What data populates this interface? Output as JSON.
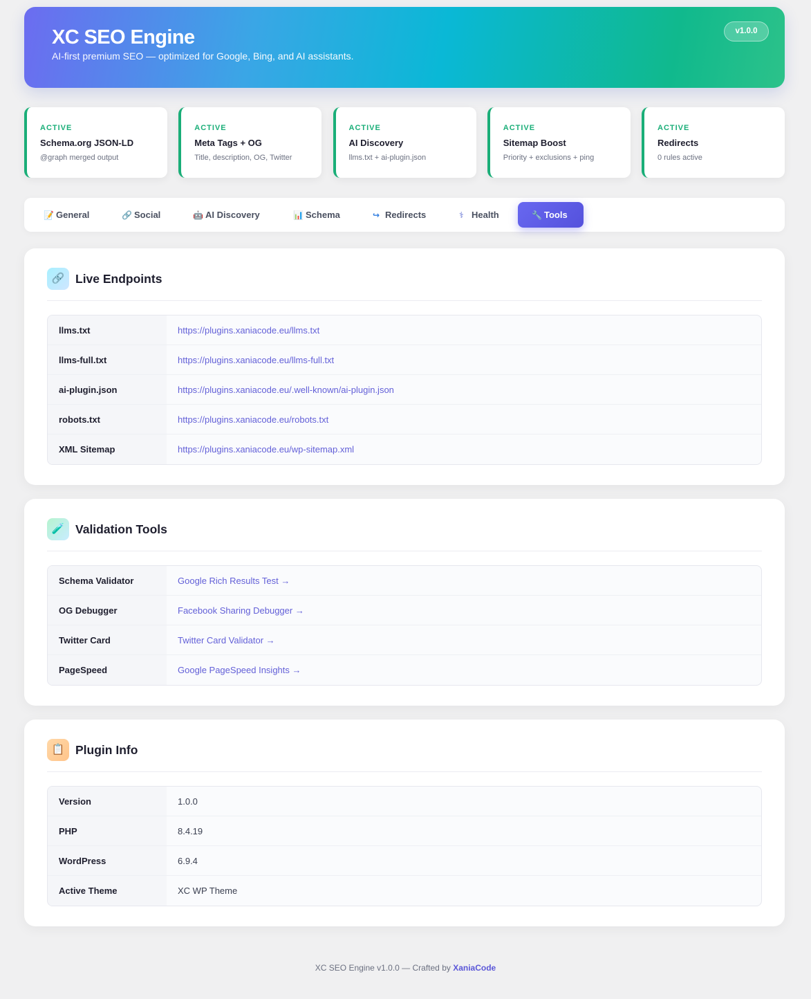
{
  "header": {
    "title": "XC SEO Engine",
    "subtitle": "AI-first premium SEO — optimized for Google, Bing, and AI assistants.",
    "version": "v1.0.0"
  },
  "status_cards": [
    {
      "status": "ACTIVE",
      "name": "Schema.org JSON-LD",
      "desc": "@graph merged output"
    },
    {
      "status": "ACTIVE",
      "name": "Meta Tags + OG",
      "desc": "Title, description, OG, Twitter"
    },
    {
      "status": "ACTIVE",
      "name": "AI Discovery",
      "desc": "llms.txt + ai-plugin.json"
    },
    {
      "status": "ACTIVE",
      "name": "Sitemap Boost",
      "desc": "Priority + exclusions + ping"
    },
    {
      "status": "ACTIVE",
      "name": "Redirects",
      "desc": "0 rules active"
    }
  ],
  "tabs": [
    {
      "label": "General",
      "icon": "📝",
      "icon_name": "memo-icon"
    },
    {
      "label": "Social",
      "icon": "🔗",
      "icon_name": "link-icon"
    },
    {
      "label": "AI Discovery",
      "icon": "🤖",
      "icon_name": "robot-icon"
    },
    {
      "label": "Schema",
      "icon": "📊",
      "icon_name": "bar-chart-icon"
    },
    {
      "label": "Redirects",
      "icon": "↪",
      "icon_name": "redirect-icon"
    },
    {
      "label": "Health",
      "icon": "⚕",
      "icon_name": "stethoscope-icon"
    },
    {
      "label": "Tools",
      "icon": "🔧",
      "icon_name": "wrench-icon",
      "active": true
    }
  ],
  "live_endpoints": {
    "title": "Live Endpoints",
    "icon": "🔗",
    "rows": [
      {
        "key": "llms.txt",
        "value": "https://plugins.xaniacode.eu/llms.txt"
      },
      {
        "key": "llms-full.txt",
        "value": "https://plugins.xaniacode.eu/llms-full.txt"
      },
      {
        "key": "ai-plugin.json",
        "value": "https://plugins.xaniacode.eu/.well-known/ai-plugin.json"
      },
      {
        "key": "robots.txt",
        "value": "https://plugins.xaniacode.eu/robots.txt"
      },
      {
        "key": "XML Sitemap",
        "value": "https://plugins.xaniacode.eu/wp-sitemap.xml"
      }
    ]
  },
  "validation_tools": {
    "title": "Validation Tools",
    "icon": "🧪",
    "rows": [
      {
        "key": "Schema Validator",
        "value": "Google Rich Results Test →"
      },
      {
        "key": "OG Debugger",
        "value": "Facebook Sharing Debugger →"
      },
      {
        "key": "Twitter Card",
        "value": "Twitter Card Validator →"
      },
      {
        "key": "PageSpeed",
        "value": "Google PageSpeed Insights →"
      }
    ]
  },
  "plugin_info": {
    "title": "Plugin Info",
    "icon": "📋",
    "rows": [
      {
        "key": "Version",
        "value": "1.0.0"
      },
      {
        "key": "PHP",
        "value": "8.4.19"
      },
      {
        "key": "WordPress",
        "value": "6.9.4"
      },
      {
        "key": "Active Theme",
        "value": "XC WP Theme"
      }
    ]
  },
  "footer": {
    "text": "XC SEO Engine v1.0.0 — Crafted by",
    "brand": "XaniaCode"
  },
  "colors": {
    "accent": "#5b57e0",
    "active_green": "#1aae78",
    "link": "#6360d8"
  }
}
